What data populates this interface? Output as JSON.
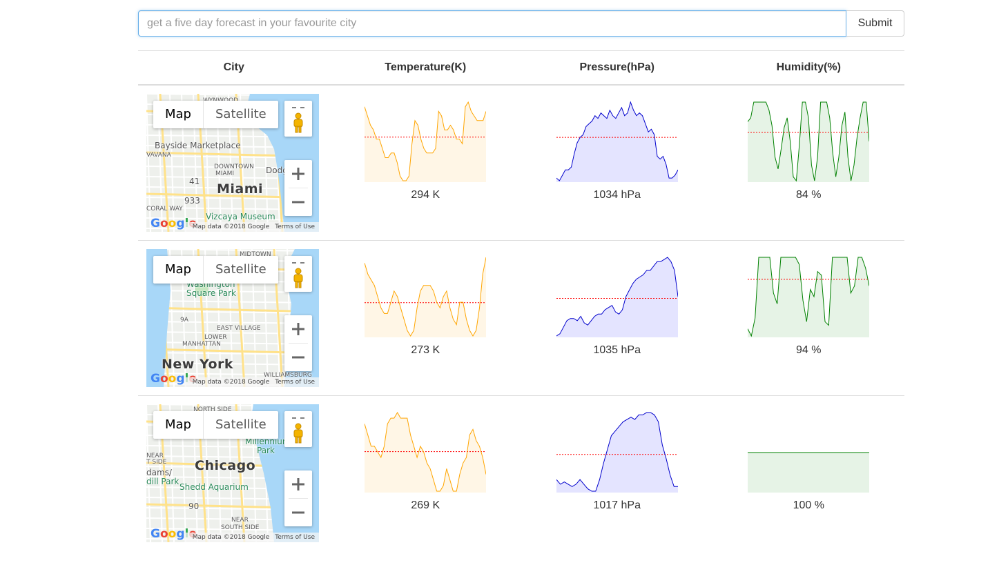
{
  "search": {
    "placeholder": "get a five day forecast in your favourite city",
    "submit_label": "Submit"
  },
  "table": {
    "headers": [
      "City",
      "Temperature(K)",
      "Pressure(hPa)",
      "Humidity(%)"
    ]
  },
  "map_controls": {
    "map_label": "Map",
    "satellite_label": "Satellite",
    "attribution": "Map data ©2018 Google",
    "terms": "Terms of Use",
    "logo": "Google"
  },
  "colors": {
    "temperature_line": "#ffa500",
    "temperature_fill": "#fff6e6",
    "pressure_line": "#0000cc",
    "pressure_fill": "#e4e4ff",
    "humidity_line": "#008000",
    "humidity_fill": "#e6f3e6",
    "average_line": "#ff0000",
    "water": "#a8d7f8"
  },
  "rows": [
    {
      "city": "Miami",
      "temperature": {
        "display": "294 K",
        "values": [
          299,
          297,
          295,
          294,
          292,
          292,
          290,
          288,
          288,
          289,
          289,
          287,
          284,
          283,
          283,
          284,
          291,
          296,
          295,
          292,
          290,
          289,
          289,
          289,
          290,
          298,
          297,
          294,
          294,
          295,
          294,
          292,
          292,
          291,
          299,
          300,
          298,
          297,
          296,
          296,
          296,
          298
        ]
      },
      "pressure": {
        "display": "1034 hPa",
        "values": [
          1013,
          1012,
          1014,
          1016,
          1016,
          1017,
          1022,
          1026,
          1028,
          1029,
          1032,
          1033,
          1034,
          1036,
          1035,
          1037,
          1036,
          1035,
          1038,
          1036,
          1035,
          1037,
          1039,
          1036,
          1037,
          1041,
          1038,
          1036,
          1037,
          1036,
          1033,
          1030,
          1031,
          1029,
          1021,
          1020,
          1021,
          1018,
          1013,
          1013,
          1014,
          1016
        ]
      },
      "humidity": {
        "display": "84 %",
        "values": [
          90,
          92,
          100,
          100,
          100,
          100,
          100,
          96,
          88,
          72,
          66,
          76,
          87,
          92,
          80,
          62,
          60,
          78,
          100,
          100,
          92,
          68,
          60,
          72,
          100,
          100,
          100,
          92,
          74,
          62,
          72,
          88,
          95,
          72,
          60,
          68,
          82,
          92,
          100,
          100,
          80
        ]
      }
    },
    {
      "city": "New York",
      "temperature": {
        "display": "273 K",
        "values": [
          278,
          276,
          275,
          274,
          272,
          270,
          269,
          269,
          271,
          273,
          272,
          270,
          268,
          266,
          265,
          266,
          270,
          273,
          274,
          274,
          274,
          273,
          271,
          270,
          272,
          273,
          270,
          268,
          267,
          271,
          271,
          268,
          266,
          265,
          266,
          270,
          276,
          279
        ]
      },
      "pressure": {
        "display": "1035 hPa",
        "values": [
          1012,
          1013,
          1016,
          1019,
          1020,
          1020,
          1019,
          1021,
          1018,
          1017,
          1019,
          1021,
          1022,
          1022,
          1024,
          1025,
          1026,
          1023,
          1022,
          1024,
          1030,
          1033,
          1036,
          1038,
          1039,
          1040,
          1042,
          1042,
          1044,
          1046,
          1046,
          1047,
          1048,
          1046,
          1042,
          1030
        ]
      },
      "humidity": {
        "display": "94 %",
        "values": [
          60,
          56,
          66,
          100,
          100,
          100,
          100,
          80,
          74,
          100,
          100,
          100,
          100,
          100,
          96,
          76,
          64,
          82,
          78,
          92,
          90,
          64,
          62,
          100,
          100,
          100,
          100,
          100,
          80,
          84,
          100,
          100,
          94,
          84
        ]
      }
    },
    {
      "city": "Chicago",
      "temperature": {
        "display": "269 K",
        "values": [
          274,
          272,
          270,
          270,
          269,
          268,
          270,
          274,
          275,
          275,
          276,
          275,
          275,
          275,
          272,
          270,
          268,
          270,
          269,
          267,
          266,
          264,
          262,
          262,
          263,
          266,
          264,
          262,
          262,
          265,
          267,
          268,
          272,
          273,
          271,
          270,
          268,
          265
        ]
      },
      "pressure": {
        "display": "1017 hPa",
        "values": [
          1010,
          1008,
          1009,
          1008,
          1007,
          1008,
          1010,
          1008,
          1006,
          1005,
          1005,
          1010,
          1017,
          1023,
          1029,
          1031,
          1033,
          1035,
          1036,
          1037,
          1036,
          1038,
          1038,
          1039,
          1039,
          1038,
          1035,
          1025,
          1019,
          1012,
          1007,
          1007
        ]
      },
      "humidity": {
        "display": "100 %",
        "values": [
          100,
          100,
          100,
          100,
          100,
          100,
          100,
          100,
          100,
          100,
          100,
          100,
          100,
          100,
          100,
          100,
          100,
          100,
          100,
          100
        ]
      }
    }
  ],
  "maps": [
    {
      "city_label": "Miami",
      "labels": [
        "WYNWOOD",
        "Bayside Marketplace",
        "DOWNTOWN",
        "MIAMI",
        "Dodg",
        "VAVANA",
        "CORAL WAY",
        "Vizcaya Museum",
        "41",
        "933"
      ]
    },
    {
      "city_label": "New York",
      "labels": [
        "MIDTOWN",
        "Washington",
        "Square Park",
        "EAST VILLAGE",
        "LOWER",
        "MANHATTAN",
        "9A",
        "WILLIAMSBURG"
      ]
    },
    {
      "city_label": "Chicago",
      "labels": [
        "NORTH SIDE",
        "Millennium",
        "Park",
        "NEAR",
        "T SIDE",
        "dams/",
        "dill Park",
        "Shedd Aquarium",
        "NEAR",
        "SOUTH SIDE",
        "90"
      ]
    }
  ]
}
